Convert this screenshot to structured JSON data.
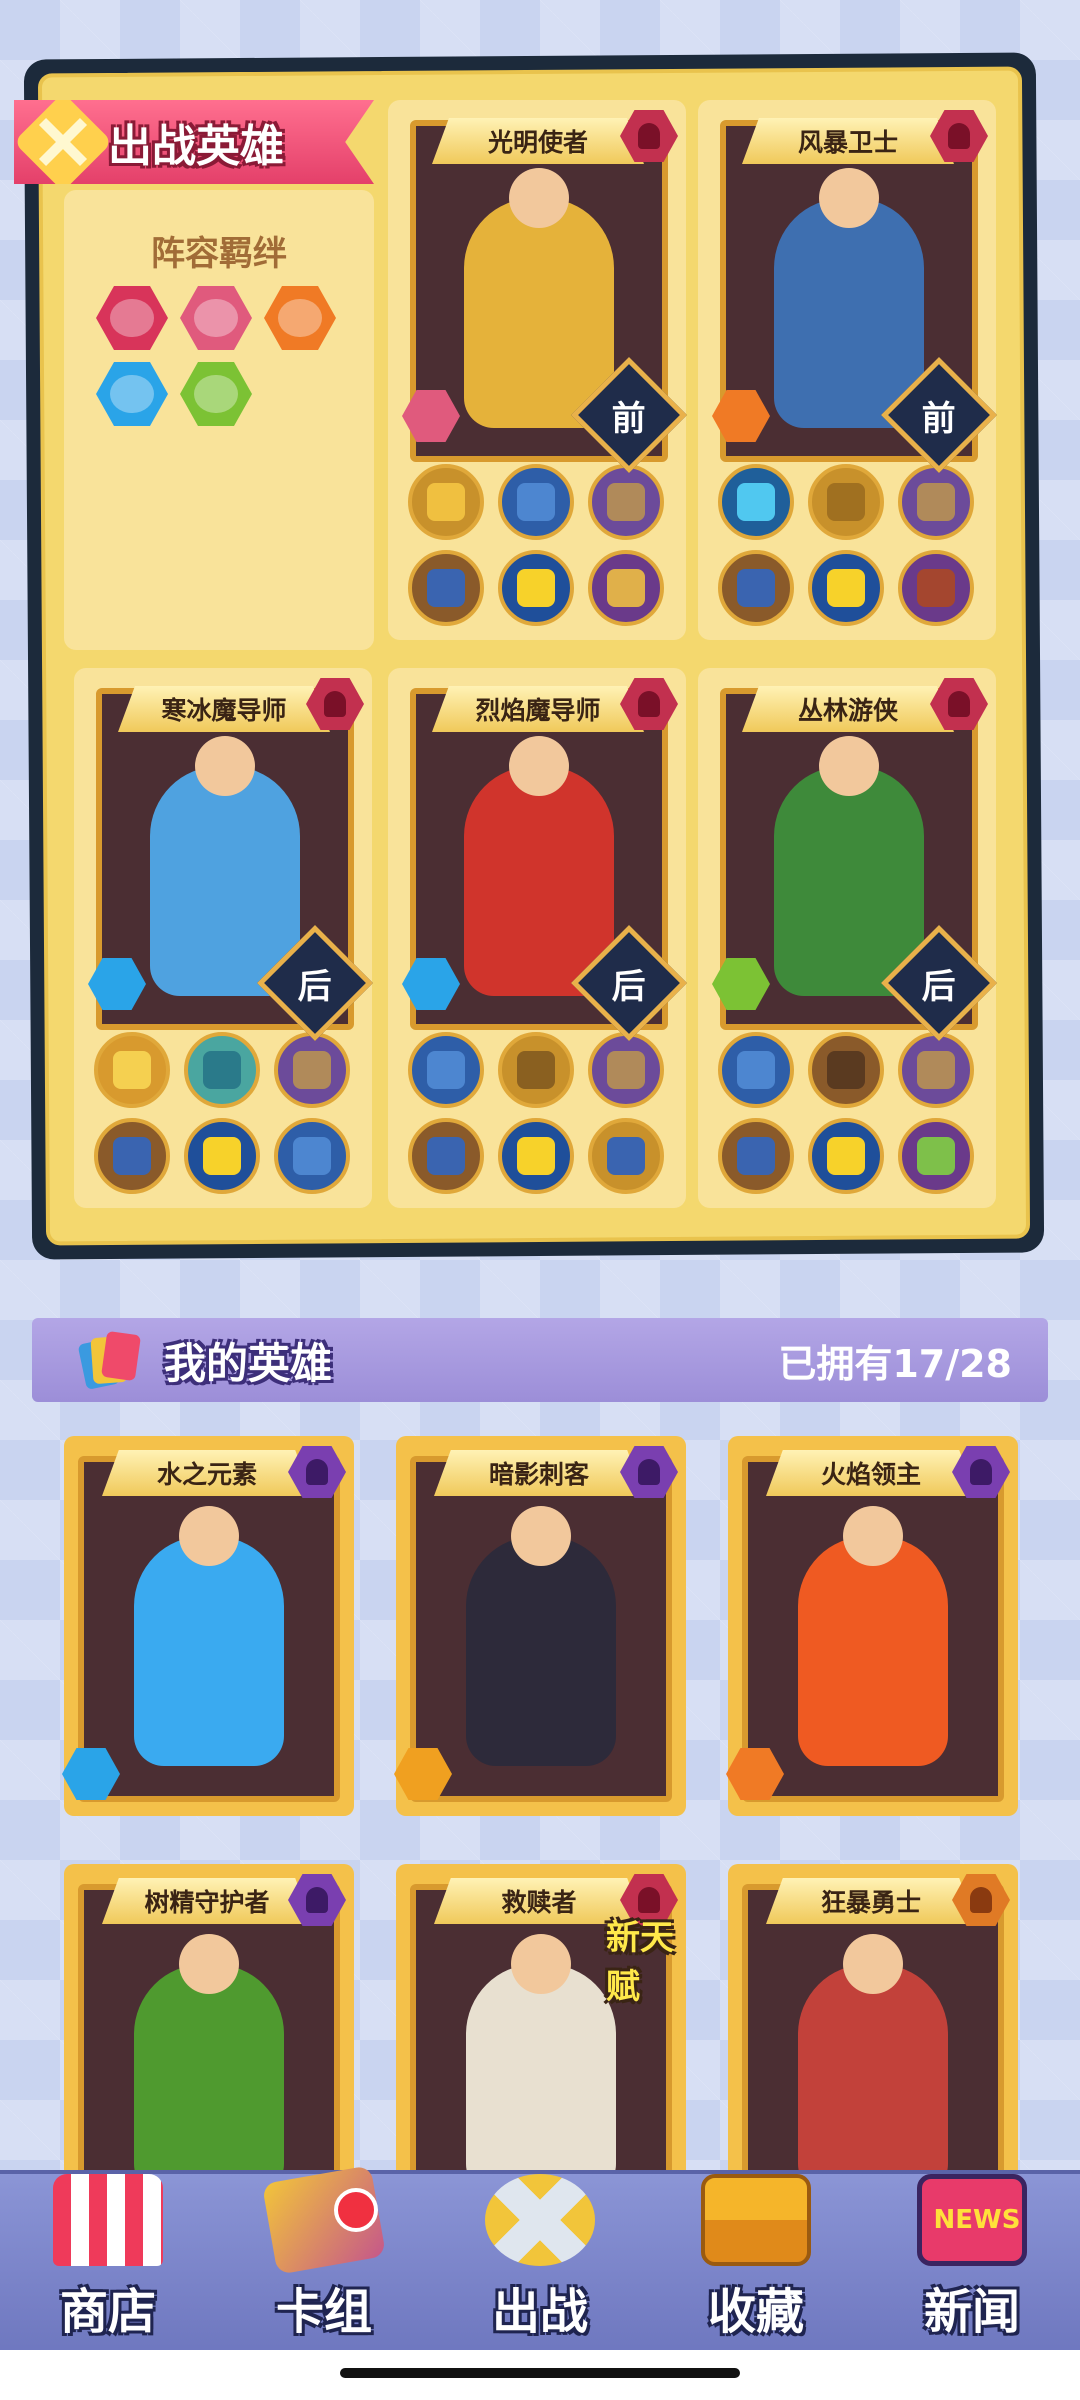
{
  "battle": {
    "title": "出战英雄",
    "bond_title": "阵容羁绊",
    "bond_icons": [
      {
        "name": "warrior-class-icon",
        "color": "#d8345a"
      },
      {
        "name": "armor-class-icon",
        "color": "#e05a7d"
      },
      {
        "name": "fire-element-icon",
        "color": "#f07a25"
      },
      {
        "name": "water-element-icon",
        "color": "#2aa4e8"
      },
      {
        "name": "nature-element-icon",
        "color": "#7cc234"
      }
    ],
    "heroes": [
      {
        "name": "光明使者",
        "position": "前",
        "theme": "#e5b23a",
        "equip": [
          "#c8912b",
          "#2e5ea8",
          "#6c4b9a",
          "#8a5a2a",
          "#f1c72a",
          "#6a3a8a"
        ]
      },
      {
        "name": "风暴卫士",
        "position": "前",
        "theme": "#3e6fb0",
        "equip": [
          "#30a6d8",
          "#c8912b",
          "#6c4b9a",
          "#8a5a2a",
          "#f1c72a",
          "#a4462f"
        ]
      },
      {
        "name": "寒冰魔导师",
        "position": "后",
        "theme": "#4fa2e0",
        "equip": [
          "#d89a2e",
          "#4aa6a0",
          "#6c4b9a",
          "#8a5a2a",
          "#f1c72a",
          "#2e5ea8"
        ]
      },
      {
        "name": "烈焰魔导师",
        "position": "后",
        "theme": "#d0342c",
        "equip": [
          "#2e5ea8",
          "#c8912b",
          "#6c4b9a",
          "#8a5a2a",
          "#f1c72a",
          "#c8912b"
        ]
      },
      {
        "name": "丛林游侠",
        "position": "后",
        "theme": "#3e8a3a",
        "equip": [
          "#2e5ea8",
          "#8a5a2a",
          "#6c4b9a",
          "#8a5a2a",
          "#f1c72a",
          "#6a3a8a"
        ]
      }
    ]
  },
  "my_heroes": {
    "title": "我的英雄",
    "owned": "已拥有17/28",
    "cards": [
      {
        "name": "水之元素",
        "theme": "#3aaaf0"
      },
      {
        "name": "暗影刺客",
        "theme": "#2d2a3a"
      },
      {
        "name": "火焰领主",
        "theme": "#ef5a22"
      },
      {
        "name": "树精守护者",
        "theme": "#4f9a2f"
      },
      {
        "name": "救赎者",
        "theme": "#e8e0d0",
        "tag": "新天赋"
      },
      {
        "name": "狂暴勇士",
        "theme": "#c2413a"
      }
    ]
  },
  "nav": [
    {
      "label": "商店",
      "icon": "shop-icon"
    },
    {
      "label": "卡组",
      "icon": "deck-icon"
    },
    {
      "label": "出战",
      "icon": "battle-swords-icon"
    },
    {
      "label": "收藏",
      "icon": "treasure-chest-icon"
    },
    {
      "label": "新闻",
      "icon": "news-tv-icon",
      "badge_text": "NEWS"
    }
  ]
}
